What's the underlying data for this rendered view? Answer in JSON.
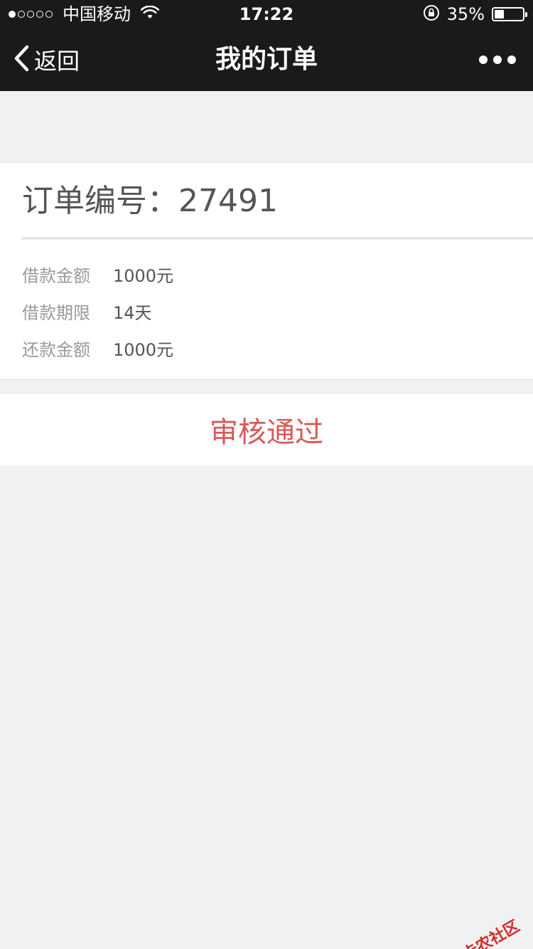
{
  "status_bar": {
    "signal_dots": [
      "filled",
      "empty",
      "empty",
      "empty",
      "empty"
    ],
    "carrier": "中国移动",
    "time": "17:22",
    "battery_percent_text": "35%",
    "battery_level": 0.35
  },
  "nav": {
    "back_label": "返回",
    "title": "我的订单"
  },
  "order": {
    "number_label": "订单编号：",
    "number_value": "27491",
    "details": [
      {
        "label": "借款金额",
        "value": "1000元"
      },
      {
        "label": "借款期限",
        "value": "14天"
      },
      {
        "label": "还款金额",
        "value": "1000元"
      }
    ]
  },
  "status": {
    "text": "审核通过",
    "color": "#d75a5a"
  },
  "watermark": {
    "text": "卡农社区"
  }
}
